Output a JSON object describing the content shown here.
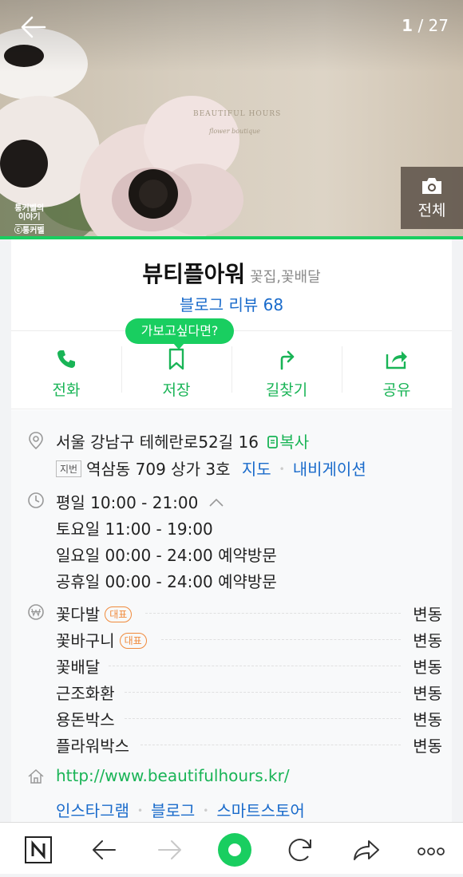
{
  "photo": {
    "counter_current": "1",
    "counter_total": "/ 27",
    "all_label": "전체",
    "watermark": [
      "통커벨의",
      "이야기",
      "ⓒ통커벨"
    ],
    "brand_text": "BEAUTIFUL HOURS",
    "brand_sub": "flower boutique"
  },
  "place": {
    "name": "뷰티플아워",
    "category": "꽃집,꽃배달",
    "review_label": "블로그 리뷰 68"
  },
  "bubble": "가보고싶다면?",
  "actions": [
    {
      "label": "전화",
      "icon": "phone-icon"
    },
    {
      "label": "저장",
      "icon": "bookmark-icon"
    },
    {
      "label": "길찾기",
      "icon": "directions-icon"
    },
    {
      "label": "공유",
      "icon": "share-icon"
    }
  ],
  "address": {
    "road": "서울 강남구 테헤란로52길 16",
    "copy_label": "복사",
    "jibun_tag": "지번",
    "jibun": "역삼동 709 상가 3호",
    "map_label": "지도",
    "navi_label": "내비게이션"
  },
  "hours": [
    "평일 10:00 - 21:00",
    "토요일 11:00 - 19:00",
    "일요일 00:00 - 24:00 예약방문",
    "공휴일 00:00 - 24:00 예약방문"
  ],
  "menu": [
    {
      "name": "꽃다발",
      "badge": "대표",
      "price": "변동"
    },
    {
      "name": "꽃바구니",
      "badge": "대표",
      "price": "변동"
    },
    {
      "name": "꽃배달",
      "badge": "",
      "price": "변동"
    },
    {
      "name": "근조화환",
      "badge": "",
      "price": "변동"
    },
    {
      "name": "용돈박스",
      "badge": "",
      "price": "변동"
    },
    {
      "name": "플라워박스",
      "badge": "",
      "price": "변동"
    }
  ],
  "website": {
    "url": "http://www.beautifulhours.kr/",
    "links": [
      "인스타그램",
      "블로그",
      "스마트스토어"
    ]
  },
  "colors": {
    "accent": "#19ce60",
    "link": "#1a6bcb",
    "badge": "#f08a3c"
  }
}
